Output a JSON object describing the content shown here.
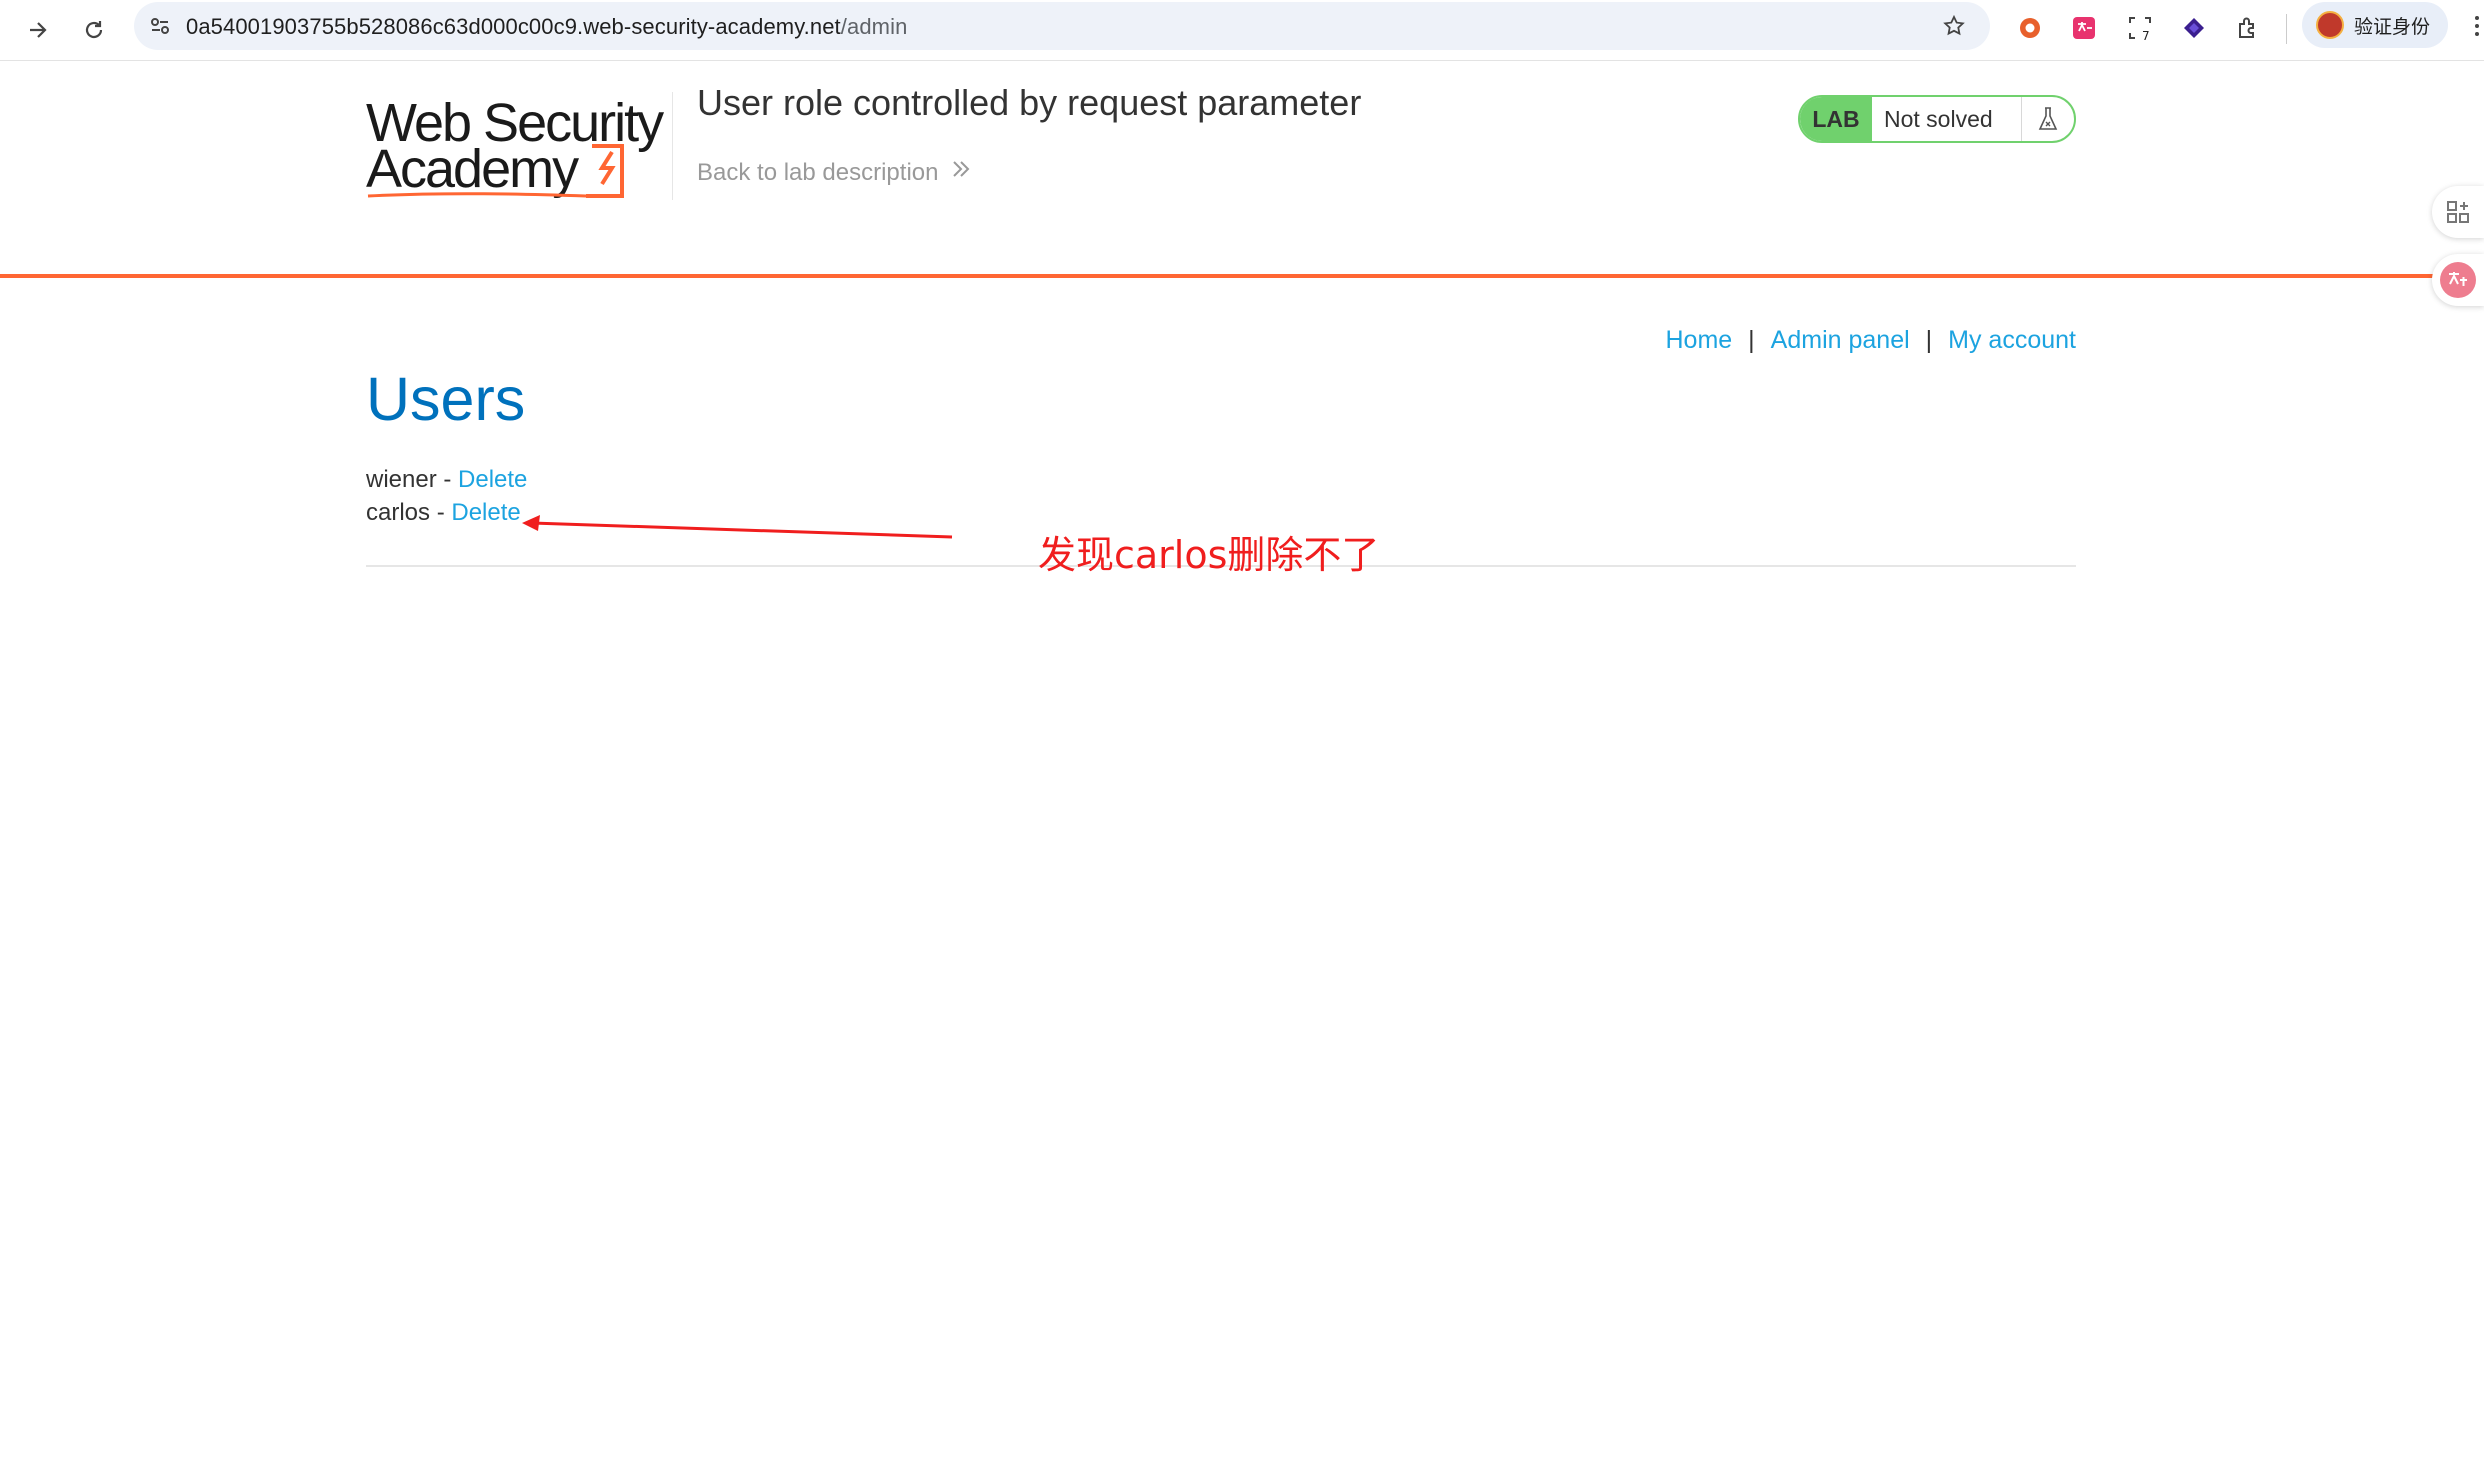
{
  "browser": {
    "url_host": "0a54001903755b528086c63d000c00c9.web-security-academy.net",
    "url_path": "/admin",
    "profile_label": "验证身份",
    "extension_badge": "7"
  },
  "header": {
    "logo_line1": "Web Security",
    "logo_line2": "Academy",
    "lab_title": "User role controlled by request parameter",
    "back_link": "Back to lab description",
    "lab_badge": "LAB",
    "lab_state": "Not solved"
  },
  "nav": {
    "home": "Home",
    "separator": "|",
    "admin_panel": "Admin panel",
    "my_account": "My account"
  },
  "main": {
    "heading": "Users",
    "users": [
      {
        "name": "wiener",
        "dash": " - ",
        "action": "Delete"
      },
      {
        "name": "carlos",
        "dash": " - ",
        "action": "Delete"
      }
    ]
  },
  "annotation": {
    "text": "发现carlos删除不了",
    "color": "#f01e1e"
  },
  "colors": {
    "accent_orange": "#ff6633",
    "heading_blue": "#0071bc",
    "link_blue": "#1ca3e0",
    "lab_green": "#70d16d"
  }
}
